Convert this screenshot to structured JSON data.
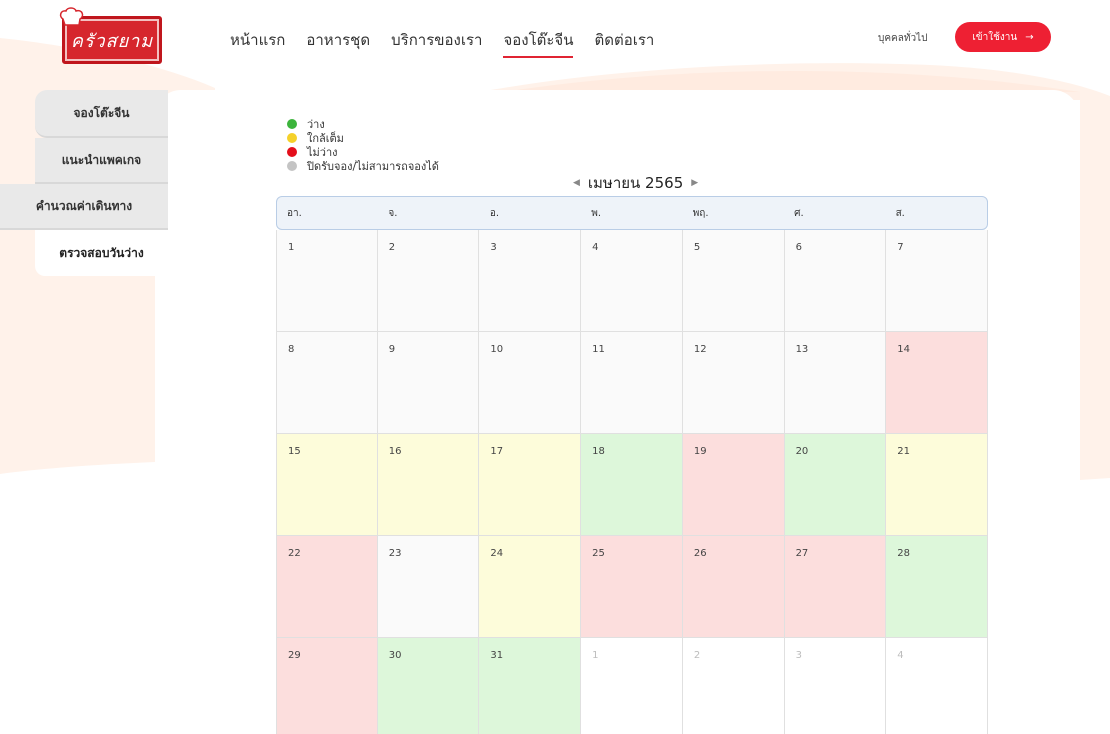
{
  "colors": {
    "accent": "#ee2033",
    "available": "#3cb43c",
    "almost_full": "#f5d12a",
    "unavailable": "#e40f1b",
    "closed": "#c4c4c4"
  },
  "header": {
    "logo_text": "ครัวสยาม",
    "nav": [
      "หน้าแรก",
      "อาหารชุด",
      "บริการของเรา",
      "จองโต๊ะจีน",
      "ติดต่อเรา"
    ],
    "active_nav": 3,
    "user_type": "บุคคลทั่วไป",
    "login_label": "เข้าใช้งาน",
    "login_icon": "arrow-right-icon"
  },
  "sidebar": {
    "items": [
      {
        "label": "จองโต๊ะจีน"
      },
      {
        "label": "แนะนำแพคเกจ"
      },
      {
        "label": "คำนวณค่าเดินทาง"
      },
      {
        "label": "ตรวจสอบวันว่าง"
      }
    ],
    "current": 3
  },
  "legend": [
    {
      "label": "ว่าง",
      "status": "free"
    },
    {
      "label": "ใกล้เต็ม",
      "status": "near"
    },
    {
      "label": "ไม่ว่าง",
      "status": "full"
    },
    {
      "label": "ปิดรับจอง/ไม่สามารถจองได้",
      "status": "closed"
    }
  ],
  "calendar": {
    "month_label": "เมษายน 2565",
    "prev_icon": "caret-left-icon",
    "next_icon": "caret-right-icon",
    "weekdays": [
      "อา.",
      "จ.",
      "อ.",
      "พ.",
      "พฤ.",
      "ศ.",
      "ส."
    ],
    "days": [
      {
        "day": "1",
        "status": "none"
      },
      {
        "day": "2",
        "status": "none"
      },
      {
        "day": "3",
        "status": "none"
      },
      {
        "day": "4",
        "status": "none"
      },
      {
        "day": "5",
        "status": "none"
      },
      {
        "day": "6",
        "status": "none"
      },
      {
        "day": "7",
        "status": "none"
      },
      {
        "day": "8",
        "status": "none"
      },
      {
        "day": "9",
        "status": "none"
      },
      {
        "day": "10",
        "status": "none"
      },
      {
        "day": "11",
        "status": "none"
      },
      {
        "day": "12",
        "status": "none"
      },
      {
        "day": "13",
        "status": "none"
      },
      {
        "day": "14",
        "status": "full"
      },
      {
        "day": "15",
        "status": "near"
      },
      {
        "day": "16",
        "status": "near"
      },
      {
        "day": "17",
        "status": "near"
      },
      {
        "day": "18",
        "status": "free"
      },
      {
        "day": "19",
        "status": "full"
      },
      {
        "day": "20",
        "status": "free"
      },
      {
        "day": "21",
        "status": "near"
      },
      {
        "day": "22",
        "status": "full"
      },
      {
        "day": "23",
        "status": "none"
      },
      {
        "day": "24",
        "status": "near"
      },
      {
        "day": "25",
        "status": "full"
      },
      {
        "day": "26",
        "status": "full"
      },
      {
        "day": "27",
        "status": "full"
      },
      {
        "day": "28",
        "status": "free"
      },
      {
        "day": "29",
        "status": "full"
      },
      {
        "day": "30",
        "status": "free"
      },
      {
        "day": "31",
        "status": "free"
      },
      {
        "day": "1",
        "status": "out"
      },
      {
        "day": "2",
        "status": "out"
      },
      {
        "day": "3",
        "status": "out"
      },
      {
        "day": "4",
        "status": "out"
      }
    ]
  }
}
